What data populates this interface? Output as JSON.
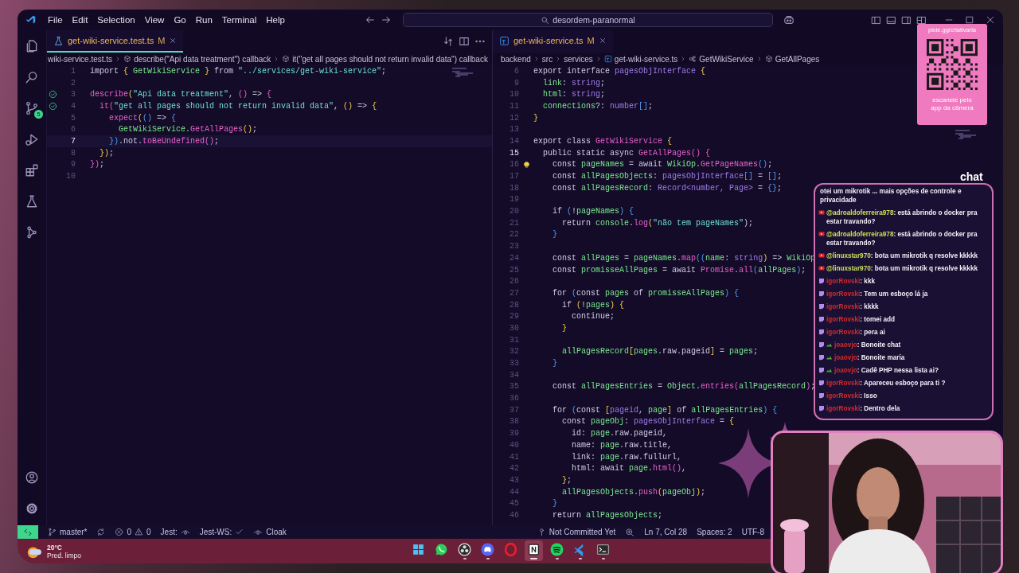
{
  "title_bar": {
    "menu": [
      "File",
      "Edit",
      "Selection",
      "View",
      "Go",
      "Run",
      "Terminal",
      "Help"
    ],
    "search": "desordem-paranormal"
  },
  "activity_bar": {
    "badge": "5"
  },
  "editors": [
    {
      "active_group": true,
      "tab": {
        "label": "get-wiki-service.test.ts",
        "status": "M",
        "kind": "test",
        "selected": true
      },
      "breadcrumbs": [
        {
          "kind": "plain",
          "text": "wiki-service.test.ts"
        },
        {
          "kind": "symbol",
          "text": "describe(\"Api data treatment\") callback"
        },
        {
          "kind": "symbol",
          "text": "it(\"get all pages should not return invalid data\") callback"
        }
      ],
      "lines": [
        {
          "n": "1",
          "current": false,
          "kind": "plain",
          "tokens": [
            {
              "text": "import ",
              "kind": "kw"
            },
            {
              "text": "{ ",
              "kind": "b1"
            },
            {
              "text": "GetWikiService",
              "kind": "var"
            },
            {
              "text": " } ",
              "kind": "b1"
            },
            {
              "text": "from ",
              "kind": "kw"
            },
            {
              "text": "\"../services/get-wiki-service\"",
              "kind": "str"
            },
            {
              "text": ";",
              "kind": "p"
            }
          ]
        },
        {
          "n": "2",
          "current": false,
          "kind": "plain"
        },
        {
          "n": "3",
          "current": false,
          "kind": "passed",
          "tokens": [
            {
              "text": "describe",
              "kind": "call"
            },
            {
              "text": "(",
              "kind": "b1"
            },
            {
              "text": "\"Api data treatment\"",
              "kind": "str"
            },
            {
              "text": ", ",
              "kind": "p"
            },
            {
              "text": "() ",
              "kind": "b2"
            },
            {
              "text": "=> ",
              "kind": "p"
            },
            {
              "text": "{",
              "kind": "b2"
            }
          ]
        },
        {
          "n": "4",
          "current": false,
          "kind": "passed",
          "tokens": [
            {
              "text": "  it",
              "kind": "call"
            },
            {
              "text": "(",
              "kind": "b2"
            },
            {
              "text": "\"get all pages should not return invalid data\"",
              "kind": "str"
            },
            {
              "text": ", ",
              "kind": "p"
            },
            {
              "text": "() ",
              "kind": "b1"
            },
            {
              "text": "=> ",
              "kind": "p"
            },
            {
              "text": "{",
              "kind": "b1"
            }
          ]
        },
        {
          "n": "5",
          "current": false,
          "kind": "plain",
          "tokens": [
            {
              "text": "    expect",
              "kind": "call"
            },
            {
              "text": "(",
              "kind": "b1"
            },
            {
              "text": "() ",
              "kind": "b3"
            },
            {
              "text": "=> ",
              "kind": "p"
            },
            {
              "text": "{",
              "kind": "b3"
            }
          ]
        },
        {
          "n": "6",
          "current": false,
          "kind": "plain",
          "tokens": [
            {
              "text": "      GetWikiService",
              "kind": "var"
            },
            {
              "text": ".",
              "kind": "p"
            },
            {
              "text": "GetAllPages",
              "kind": "call"
            },
            {
              "text": "()",
              "kind": "b1"
            },
            {
              "text": ";",
              "kind": "p"
            }
          ]
        },
        {
          "n": "7",
          "current": true,
          "kind": "plain",
          "tokens": [
            {
              "text": "    })",
              "kind": "b3"
            },
            {
              "text": ".not.",
              "kind": "p"
            },
            {
              "text": "toBeUndefined",
              "kind": "call"
            },
            {
              "text": "()",
              "kind": "b2"
            },
            {
              "text": ";",
              "kind": "p"
            }
          ]
        },
        {
          "n": "8",
          "current": false,
          "kind": "plain",
          "tokens": [
            {
              "text": "  })",
              "kind": "b1"
            },
            {
              "text": ";",
              "kind": "p"
            }
          ]
        },
        {
          "n": "9",
          "current": false,
          "kind": "plain",
          "tokens": [
            {
              "text": "})",
              "kind": "b2"
            },
            {
              "text": ";",
              "kind": "p"
            }
          ]
        },
        {
          "n": "10",
          "current": false,
          "kind": "plain"
        }
      ]
    },
    {
      "active_group": false,
      "tab": {
        "label": "get-wiki-service.ts",
        "status": "M",
        "kind": "ts",
        "selected": true
      },
      "breadcrumbs": [
        {
          "kind": "plain",
          "text": "backend"
        },
        {
          "kind": "plain",
          "text": "src"
        },
        {
          "kind": "plain",
          "text": "services"
        },
        {
          "kind": "file",
          "text": "get-wiki-service.ts"
        },
        {
          "kind": "class",
          "text": "GetWikiService"
        },
        {
          "kind": "symbol",
          "text": "GetAllPages"
        }
      ],
      "lines": [
        {
          "n": "6",
          "current": false,
          "kind": "plain",
          "tokens": [
            {
              "text": "export interface ",
              "kind": "kw"
            },
            {
              "text": "pagesObjInterface ",
              "kind": "type"
            },
            {
              "text": "{",
              "kind": "b1"
            }
          ]
        },
        {
          "n": "9",
          "current": false,
          "kind": "plain",
          "tokens": [
            {
              "text": "  link",
              "kind": "var"
            },
            {
              "text": ": ",
              "kind": "p"
            },
            {
              "text": "string",
              "kind": "type"
            },
            {
              "text": ";",
              "kind": "p"
            }
          ]
        },
        {
          "n": "10",
          "current": false,
          "kind": "plain",
          "tokens": [
            {
              "text": "  html",
              "kind": "var"
            },
            {
              "text": ": ",
              "kind": "p"
            },
            {
              "text": "string",
              "kind": "type"
            },
            {
              "text": ";",
              "kind": "p"
            }
          ]
        },
        {
          "n": "11",
          "current": false,
          "kind": "plain",
          "tokens": [
            {
              "text": "  connections",
              "kind": "var"
            },
            {
              "text": "?: ",
              "kind": "p"
            },
            {
              "text": "number",
              "kind": "type"
            },
            {
              "text": "[]",
              "kind": "b3"
            },
            {
              "text": ";",
              "kind": "p"
            }
          ]
        },
        {
          "n": "12",
          "current": false,
          "kind": "plain",
          "tokens": [
            {
              "text": "}",
              "kind": "b1"
            }
          ]
        },
        {
          "n": "13",
          "current": false,
          "kind": "plain"
        },
        {
          "n": "14",
          "current": false,
          "kind": "plain",
          "tokens": [
            {
              "text": "export class ",
              "kind": "kw"
            },
            {
              "text": "GetWikiService ",
              "kind": "call"
            },
            {
              "text": "{",
              "kind": "b1"
            }
          ]
        },
        {
          "n": "15",
          "current": true,
          "kind": "plain",
          "tokens": [
            {
              "text": "  public static async ",
              "kind": "kw"
            },
            {
              "text": "GetAllPages",
              "kind": "call"
            },
            {
              "text": "() ",
              "kind": "b2"
            },
            {
              "text": "{",
              "kind": "b2"
            }
          ]
        },
        {
          "n": "16",
          "current": false,
          "kind": "lightbulb",
          "tokens": [
            {
              "text": "    const ",
              "kind": "kw"
            },
            {
              "text": "pageNames",
              "kind": "var"
            },
            {
              "text": " = ",
              "kind": "p"
            },
            {
              "text": "await ",
              "kind": "kw"
            },
            {
              "text": "WikiOp",
              "kind": "var"
            },
            {
              "text": ".",
              "kind": "p"
            },
            {
              "text": "GetPageNames",
              "kind": "call"
            },
            {
              "text": "()",
              "kind": "b3"
            },
            {
              "text": ";",
              "kind": "p"
            }
          ]
        },
        {
          "n": "17",
          "current": false,
          "kind": "plain",
          "tokens": [
            {
              "text": "    const ",
              "kind": "kw"
            },
            {
              "text": "allPagesObjects",
              "kind": "var"
            },
            {
              "text": ": ",
              "kind": "p"
            },
            {
              "text": "pagesObjInterface",
              "kind": "type"
            },
            {
              "text": "[]",
              "kind": "b3"
            },
            {
              "text": " = ",
              "kind": "p"
            },
            {
              "text": "[]",
              "kind": "b3"
            },
            {
              "text": ";",
              "kind": "p"
            }
          ]
        },
        {
          "n": "18",
          "current": false,
          "kind": "plain",
          "tokens": [
            {
              "text": "    const ",
              "kind": "kw"
            },
            {
              "text": "allPagesRecord",
              "kind": "var"
            },
            {
              "text": ": ",
              "kind": "p"
            },
            {
              "text": "Record<number, Page>",
              "kind": "type"
            },
            {
              "text": " = ",
              "kind": "p"
            },
            {
              "text": "{}",
              "kind": "b3"
            },
            {
              "text": ";",
              "kind": "p"
            }
          ]
        },
        {
          "n": "19",
          "current": false,
          "kind": "plain"
        },
        {
          "n": "20",
          "current": false,
          "kind": "plain",
          "tokens": [
            {
              "text": "    if ",
              "kind": "kw"
            },
            {
              "text": "(",
              "kind": "b3"
            },
            {
              "text": "!",
              "kind": "p"
            },
            {
              "text": "pageNames",
              "kind": "var"
            },
            {
              "text": ") ",
              "kind": "b3"
            },
            {
              "text": "{",
              "kind": "b3"
            }
          ]
        },
        {
          "n": "21",
          "current": false,
          "kind": "plain",
          "tokens": [
            {
              "text": "      return ",
              "kind": "kw"
            },
            {
              "text": "console",
              "kind": "var"
            },
            {
              "text": ".",
              "kind": "p"
            },
            {
              "text": "log",
              "kind": "call"
            },
            {
              "text": "(",
              "kind": "b1"
            },
            {
              "text": "\"não tem pageNames\"",
              "kind": "str"
            },
            {
              "text": ");",
              "kind": "p"
            }
          ]
        },
        {
          "n": "22",
          "current": false,
          "kind": "plain",
          "tokens": [
            {
              "text": "    }",
              "kind": "b3"
            }
          ]
        },
        {
          "n": "23",
          "current": false,
          "kind": "plain"
        },
        {
          "n": "24",
          "current": false,
          "kind": "plain",
          "tokens": [
            {
              "text": "    const ",
              "kind": "kw"
            },
            {
              "text": "allPages",
              "kind": "var"
            },
            {
              "text": " = ",
              "kind": "p"
            },
            {
              "text": "pageNames",
              "kind": "var"
            },
            {
              "text": ".",
              "kind": "p"
            },
            {
              "text": "map",
              "kind": "call"
            },
            {
              "text": "((",
              "kind": "b3"
            },
            {
              "text": "name",
              "kind": "var"
            },
            {
              "text": ": ",
              "kind": "p"
            },
            {
              "text": "string",
              "kind": "type"
            },
            {
              "text": ") ",
              "kind": "b1"
            },
            {
              "text": "=> ",
              "kind": "p"
            },
            {
              "text": "WikiOp",
              "kind": "var"
            }
          ]
        },
        {
          "n": "25",
          "current": false,
          "kind": "plain",
          "tokens": [
            {
              "text": "    const ",
              "kind": "kw"
            },
            {
              "text": "promisseAllPages",
              "kind": "var"
            },
            {
              "text": " = ",
              "kind": "p"
            },
            {
              "text": "await ",
              "kind": "kw"
            },
            {
              "text": "Promise",
              "kind": "call"
            },
            {
              "text": ".",
              "kind": "p"
            },
            {
              "text": "all",
              "kind": "call"
            },
            {
              "text": "(",
              "kind": "b3"
            },
            {
              "text": "allPages",
              "kind": "var"
            },
            {
              "text": ")",
              "kind": "b3"
            },
            {
              "text": ";",
              "kind": "p"
            }
          ]
        },
        {
          "n": "26",
          "current": false,
          "kind": "plain"
        },
        {
          "n": "27",
          "current": false,
          "kind": "plain",
          "tokens": [
            {
              "text": "    for ",
              "kind": "kw"
            },
            {
              "text": "(",
              "kind": "b3"
            },
            {
              "text": "const ",
              "kind": "kw"
            },
            {
              "text": "pages ",
              "kind": "var"
            },
            {
              "text": "of ",
              "kind": "kw"
            },
            {
              "text": "promisseAllPages",
              "kind": "var"
            },
            {
              "text": ") ",
              "kind": "b3"
            },
            {
              "text": "{",
              "kind": "b3"
            }
          ]
        },
        {
          "n": "28",
          "current": false,
          "kind": "plain",
          "tokens": [
            {
              "text": "      if ",
              "kind": "kw"
            },
            {
              "text": "(",
              "kind": "b1"
            },
            {
              "text": "!",
              "kind": "p"
            },
            {
              "text": "pages",
              "kind": "var"
            },
            {
              "text": ") ",
              "kind": "b1"
            },
            {
              "text": "{",
              "kind": "b1"
            }
          ]
        },
        {
          "n": "29",
          "current": false,
          "kind": "plain",
          "tokens": [
            {
              "text": "        continue;",
              "kind": "kw"
            }
          ]
        },
        {
          "n": "30",
          "current": false,
          "kind": "plain",
          "tokens": [
            {
              "text": "      }",
              "kind": "b1"
            }
          ]
        },
        {
          "n": "31",
          "current": false,
          "kind": "plain"
        },
        {
          "n": "32",
          "current": false,
          "kind": "plain",
          "tokens": [
            {
              "text": "      allPagesRecord",
              "kind": "var"
            },
            {
              "text": "[",
              "kind": "b1"
            },
            {
              "text": "pages",
              "kind": "var"
            },
            {
              "text": ".raw.pageid",
              "kind": "p"
            },
            {
              "text": "]",
              "kind": "b1"
            },
            {
              "text": " = ",
              "kind": "p"
            },
            {
              "text": "pages",
              "kind": "var"
            },
            {
              "text": ";",
              "kind": "p"
            }
          ]
        },
        {
          "n": "33",
          "current": false,
          "kind": "plain",
          "tokens": [
            {
              "text": "    }",
              "kind": "b3"
            }
          ]
        },
        {
          "n": "34",
          "current": false,
          "kind": "plain"
        },
        {
          "n": "35",
          "current": false,
          "kind": "plain",
          "tokens": [
            {
              "text": "    const ",
              "kind": "kw"
            },
            {
              "text": "allPagesEntries",
              "kind": "var"
            },
            {
              "text": " = ",
              "kind": "p"
            },
            {
              "text": "Object",
              "kind": "var"
            },
            {
              "text": ".",
              "kind": "p"
            },
            {
              "text": "entries",
              "kind": "call"
            },
            {
              "text": "(",
              "kind": "b2"
            },
            {
              "text": "allPagesRecord",
              "kind": "var"
            },
            {
              "text": ")",
              "kind": "b2"
            },
            {
              "text": ";",
              "kind": "p"
            }
          ]
        },
        {
          "n": "36",
          "current": false,
          "kind": "plain"
        },
        {
          "n": "37",
          "current": false,
          "kind": "plain",
          "tokens": [
            {
              "text": "    for ",
              "kind": "kw"
            },
            {
              "text": "(",
              "kind": "b3"
            },
            {
              "text": "const ",
              "kind": "kw"
            },
            {
              "text": "[",
              "kind": "b1"
            },
            {
              "text": "pageid",
              "kind": "type"
            },
            {
              "text": ", ",
              "kind": "p"
            },
            {
              "text": "page",
              "kind": "var"
            },
            {
              "text": "] ",
              "kind": "b1"
            },
            {
              "text": "of ",
              "kind": "kw"
            },
            {
              "text": "allPagesEntries",
              "kind": "var"
            },
            {
              "text": ") ",
              "kind": "b3"
            },
            {
              "text": "{",
              "kind": "b3"
            }
          ]
        },
        {
          "n": "38",
          "current": false,
          "kind": "plain",
          "tokens": [
            {
              "text": "      const ",
              "kind": "kw"
            },
            {
              "text": "pageObj",
              "kind": "var"
            },
            {
              "text": ": ",
              "kind": "p"
            },
            {
              "text": "pagesObjInterface",
              "kind": "type"
            },
            {
              "text": " = ",
              "kind": "p"
            },
            {
              "text": "{",
              "kind": "b1"
            }
          ]
        },
        {
          "n": "39",
          "current": false,
          "kind": "plain",
          "tokens": [
            {
              "text": "        id: ",
              "kind": "p"
            },
            {
              "text": "page",
              "kind": "var"
            },
            {
              "text": ".raw.pageid,",
              "kind": "p"
            }
          ]
        },
        {
          "n": "40",
          "current": false,
          "kind": "plain",
          "tokens": [
            {
              "text": "        name: ",
              "kind": "p"
            },
            {
              "text": "page",
              "kind": "var"
            },
            {
              "text": ".raw.title,",
              "kind": "p"
            }
          ]
        },
        {
          "n": "41",
          "current": false,
          "kind": "plain",
          "tokens": [
            {
              "text": "        link: ",
              "kind": "p"
            },
            {
              "text": "page",
              "kind": "var"
            },
            {
              "text": ".raw.fullurl,",
              "kind": "p"
            }
          ]
        },
        {
          "n": "42",
          "current": false,
          "kind": "plain",
          "tokens": [
            {
              "text": "        html: await ",
              "kind": "p"
            },
            {
              "text": "page",
              "kind": "var"
            },
            {
              "text": ".",
              "kind": "p"
            },
            {
              "text": "html",
              "kind": "call"
            },
            {
              "text": "()",
              "kind": "b2"
            },
            {
              "text": ",",
              "kind": "p"
            }
          ]
        },
        {
          "n": "43",
          "current": false,
          "kind": "plain",
          "tokens": [
            {
              "text": "      }",
              "kind": "b1"
            },
            {
              "text": ";",
              "kind": "p"
            }
          ]
        },
        {
          "n": "44",
          "current": false,
          "kind": "plain",
          "tokens": [
            {
              "text": "      allPagesObjects",
              "kind": "var"
            },
            {
              "text": ".",
              "kind": "p"
            },
            {
              "text": "push",
              "kind": "call"
            },
            {
              "text": "(",
              "kind": "b1"
            },
            {
              "text": "pageObj",
              "kind": "var"
            },
            {
              "text": ")",
              "kind": "b1"
            },
            {
              "text": ";",
              "kind": "p"
            }
          ]
        },
        {
          "n": "45",
          "current": false,
          "kind": "plain",
          "tokens": [
            {
              "text": "    }",
              "kind": "b3"
            }
          ]
        },
        {
          "n": "46",
          "current": false,
          "kind": "plain",
          "tokens": [
            {
              "text": "    return ",
              "kind": "kw"
            },
            {
              "text": "allPagesObjects",
              "kind": "var"
            },
            {
              "text": ";",
              "kind": "p"
            }
          ]
        }
      ]
    }
  ],
  "status_bar": {
    "left": [
      {
        "kind": "remote"
      },
      {
        "kind": "branch",
        "text": "master*"
      },
      {
        "kind": "sync"
      },
      {
        "kind": "problems",
        "errors": "0",
        "warnings": "0"
      },
      {
        "kind": "text_eye",
        "text": "Jest:"
      },
      {
        "kind": "text_check",
        "text": "Jest-WS:"
      },
      {
        "kind": "eye_text",
        "text": "Cloak"
      }
    ],
    "right": [
      {
        "kind": "blame",
        "text": "Not Committed Yet"
      },
      {
        "kind": "zoom"
      },
      {
        "kind": "text",
        "text": "Ln 7, Col 28"
      },
      {
        "kind": "text",
        "text": "Spaces: 2"
      },
      {
        "kind": "text",
        "text": "UTF-8"
      }
    ]
  },
  "taskbar": {
    "weather": {
      "temp": "20°C",
      "forecast": "Pred. limpo"
    },
    "apps": [
      {
        "kind": "start",
        "running": false,
        "active": false
      },
      {
        "kind": "phone",
        "running": false,
        "active": false
      },
      {
        "kind": "aperture",
        "running": true,
        "active": false
      },
      {
        "kind": "gamepad",
        "running": true,
        "active": false
      },
      {
        "kind": "ring",
        "running": false,
        "active": false
      },
      {
        "kind": "notebook",
        "running": true,
        "active": true
      },
      {
        "kind": "waves",
        "running": true,
        "active": false
      },
      {
        "kind": "editor",
        "running": true,
        "active": false
      },
      {
        "kind": "terminal",
        "running": true,
        "active": false
      }
    ]
  },
  "qr_card": {
    "url": "pixie.gg/criativaria",
    "caption": [
      "escaneie pelo",
      "app da câmera"
    ]
  },
  "chat": {
    "title": "chat",
    "messages": [
      {
        "kind": "plain",
        "text": "otei um mikrotik ... mais opções de controle e privacidade"
      },
      {
        "kind": "youtube",
        "user": "@adroaldoferreira978",
        "color": "#c8e05a",
        "text": ": está abrindo o docker pra estar travando?"
      },
      {
        "kind": "youtube",
        "user": "@adroaldoferreira978",
        "color": "#c8e05a",
        "text": ": está abrindo o docker pra estar travando?"
      },
      {
        "kind": "youtube",
        "user": "@linuxstar970",
        "color": "#c8e05a",
        "text": ": bota um mikrotik q resolve kkkkk"
      },
      {
        "kind": "youtube",
        "user": "@linuxstar970",
        "color": "#c8e05a",
        "text": ": bota um mikrotik q resolve kkkkk"
      },
      {
        "kind": "twitch",
        "user": "igorRovski",
        "color": "#d62a2a",
        "text": ": kkk"
      },
      {
        "kind": "twitch",
        "user": "igorRovski",
        "color": "#d62a2a",
        "text": ": Tem um esboço lá ja"
      },
      {
        "kind": "twitch",
        "user": "igorRovski",
        "color": "#d62a2a",
        "text": ": kkkk"
      },
      {
        "kind": "twitch",
        "user": "igorRovski",
        "color": "#d62a2a",
        "text": ": tomei add"
      },
      {
        "kind": "twitch",
        "user": "igorRovski",
        "color": "#d62a2a",
        "text": ": pera ai"
      },
      {
        "kind": "twitch_badge",
        "user": "joaovjo",
        "color": "#d62a2a",
        "text": ": Bonoite chat"
      },
      {
        "kind": "twitch_badge",
        "user": "joaovjo",
        "color": "#d62a2a",
        "text": ": Bonoite maria"
      },
      {
        "kind": "twitch_badge",
        "user": "joaovjo",
        "color": "#d62a2a",
        "text": ": Cadê PHP nessa lista ai?"
      },
      {
        "kind": "twitch",
        "user": "igorRovski",
        "color": "#d62a2a",
        "text": ": Apareceu esboço para ti ?"
      },
      {
        "kind": "twitch",
        "user": "igorRovski",
        "color": "#d62a2a",
        "text": ": Isso"
      },
      {
        "kind": "twitch",
        "user": "igorRovski",
        "color": "#d62a2a",
        "text": ": Dentro dela"
      }
    ]
  }
}
